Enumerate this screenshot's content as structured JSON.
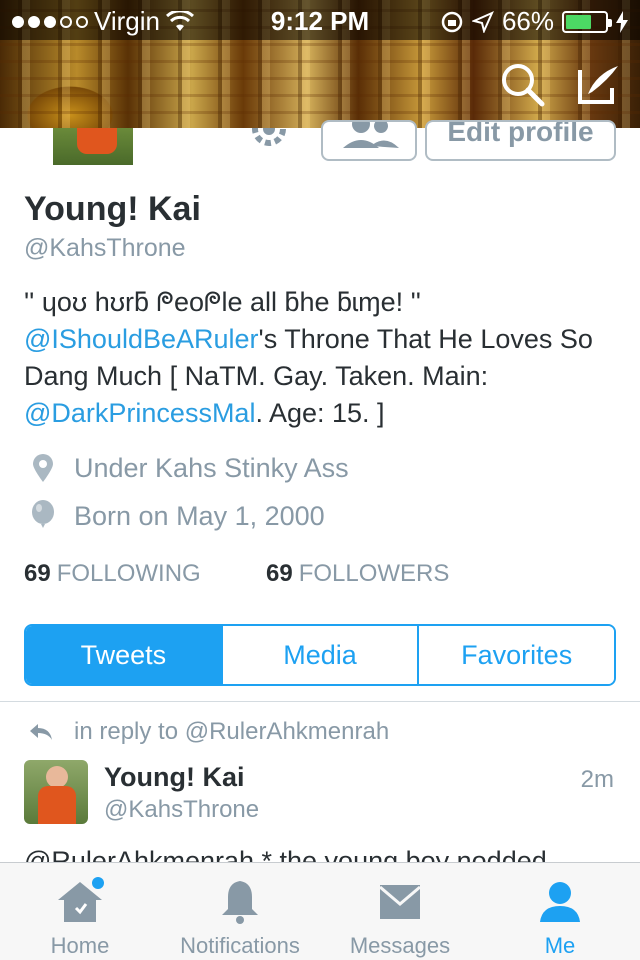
{
  "status_bar": {
    "carrier": "Virgin",
    "time": "9:12 PM",
    "battery_percent": "66%",
    "battery_level": 0.66,
    "signal_bars_filled": 3,
    "signal_bars_total": 5
  },
  "header": {
    "search_icon": "search-icon",
    "compose_icon": "compose-tweet-icon"
  },
  "profile": {
    "settings_icon": "gear-icon",
    "follow_icon": "people-icon",
    "edit_label": "Edit profile",
    "name": "Young! Kai",
    "handle": "@KahsThrone",
    "bio": {
      "line1": "'' ɥoʊ hʊrƃ ᖘeoᖘle all ƃhe ƃɩɱe! ''",
      "mention1": "@IShouldBeARuler",
      "text1": "'s Throne That He Loves So Dang Much [ NaTM. Gay. Taken. Main: ",
      "mention2": "@DarkPrincessMal",
      "text2": ". Age: 15. ]"
    },
    "location": "Under Kahs Stinky Ass",
    "birthday": "Born on May 1, 2000",
    "following_count": "69",
    "following_label": "FOLLOWING",
    "followers_count": "69",
    "followers_label": "FOLLOWERS"
  },
  "tabs": {
    "tweets": "Tweets",
    "media": "Media",
    "favorites": "Favorites"
  },
  "tweet": {
    "reply_to": "in reply to @RulerAhkmenrah",
    "name": "Young! Kai",
    "handle": "@KahsThrone",
    "time": "2m",
    "text": "@RulerAhkmenrah * the young boy nodded"
  },
  "tabbar": {
    "home": "Home",
    "notifications": "Notifications",
    "messages": "Messages",
    "me": "Me"
  },
  "colors": {
    "accent": "#1da1f2",
    "link": "#2a9de1",
    "muted": "#8899a6",
    "text": "#292f33"
  }
}
